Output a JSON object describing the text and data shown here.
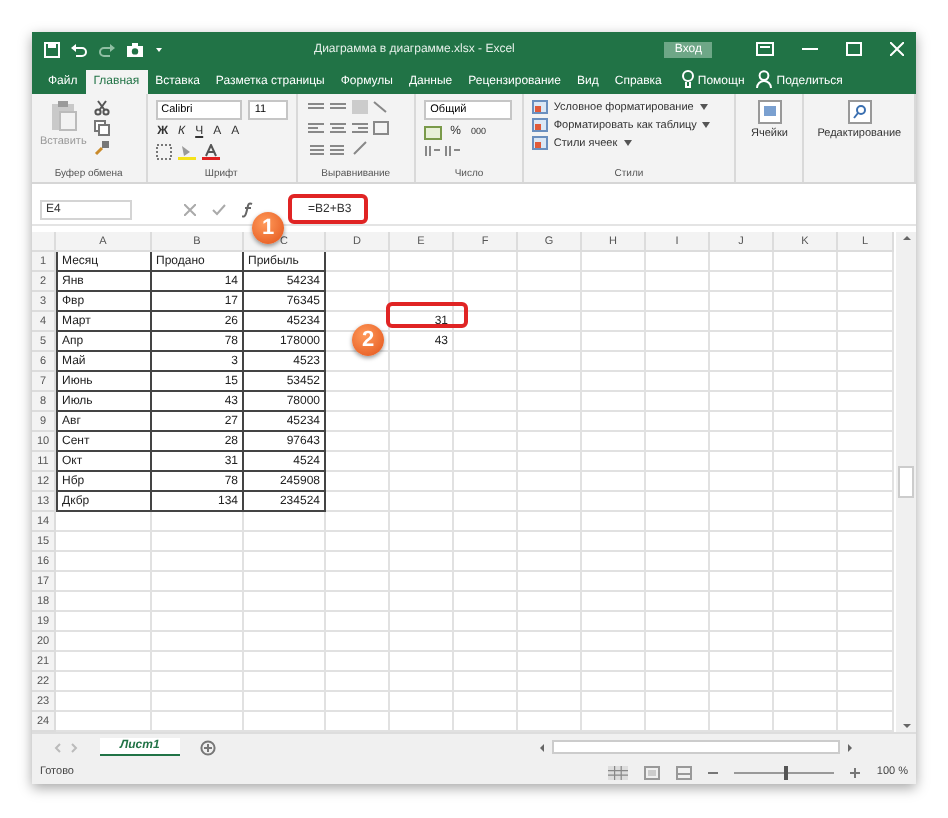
{
  "window": {
    "title": "Диаграмма в диаграмме.xlsx - Excel",
    "login_button": "Вход"
  },
  "menu_tabs": [
    {
      "label": "Файл",
      "selected": false
    },
    {
      "label": "Главная",
      "selected": true
    },
    {
      "label": "Вставка",
      "selected": false
    },
    {
      "label": "Разметка страницы",
      "selected": false
    },
    {
      "label": "Формулы",
      "selected": false
    },
    {
      "label": "Данные",
      "selected": false
    },
    {
      "label": "Рецензирование",
      "selected": false
    },
    {
      "label": "Вид",
      "selected": false
    },
    {
      "label": "Справка",
      "selected": false
    }
  ],
  "tell_me": "Помощн",
  "share": "Поделиться",
  "ribbon": {
    "clipboard": {
      "paste": "Вставить",
      "label": "Буфер обмена"
    },
    "font": {
      "font_name": "Calibri",
      "font_size": "11",
      "styles": [
        "Ж",
        "К",
        "Ч"
      ],
      "grow": "A",
      "shrink": "A",
      "label": "Шрифт"
    },
    "alignment": {
      "label": "Выравнивание"
    },
    "number": {
      "format": "Общий",
      "percent": "%",
      "thousands": "000",
      "label": "Число"
    },
    "styles": {
      "items": [
        "Условное форматирование",
        "Форматировать как таблицу",
        "Стили ячеек"
      ],
      "label": "Стили"
    },
    "cells": {
      "label": "Ячейки"
    },
    "editing": {
      "label": "Редактирование"
    }
  },
  "formula_bar": {
    "name_box": "E4",
    "formula": "=B2+B3"
  },
  "sheet": {
    "columns": [
      "A",
      "B",
      "C",
      "D",
      "E",
      "F",
      "G",
      "H",
      "I",
      "J",
      "K",
      "L"
    ],
    "rows": [
      {
        "number": "1",
        "kind": "header",
        "a": "Месяц",
        "b": "Продано",
        "c": "Прибыль"
      },
      {
        "number": "2",
        "kind": "data",
        "a": "Янв",
        "b": "14",
        "c": "54234"
      },
      {
        "number": "3",
        "kind": "data",
        "a": "Фвр",
        "b": "17",
        "c": "76345"
      },
      {
        "number": "4",
        "kind": "data",
        "a": "Март",
        "b": "26",
        "c": "45234",
        "e": "31"
      },
      {
        "number": "5",
        "kind": "data",
        "a": "Апр",
        "b": "78",
        "c": "178000",
        "e": "43"
      },
      {
        "number": "6",
        "kind": "data",
        "a": "Май",
        "b": "3",
        "c": "4523"
      },
      {
        "number": "7",
        "kind": "data",
        "a": "Июнь",
        "b": "15",
        "c": "53452"
      },
      {
        "number": "8",
        "kind": "data",
        "a": "Июль",
        "b": "43",
        "c": "78000"
      },
      {
        "number": "9",
        "kind": "data",
        "a": "Авг",
        "b": "27",
        "c": "45234"
      },
      {
        "number": "10",
        "kind": "data",
        "a": "Сент",
        "b": "28",
        "c": "97643"
      },
      {
        "number": "11",
        "kind": "data",
        "a": "Окт",
        "b": "31",
        "c": "4524"
      },
      {
        "number": "12",
        "kind": "data",
        "a": "Нбр",
        "b": "78",
        "c": "245908"
      },
      {
        "number": "13",
        "kind": "data",
        "a": "Дкбр",
        "b": "134",
        "c": "234524"
      },
      {
        "number": "14",
        "kind": "empty"
      },
      {
        "number": "15",
        "kind": "empty"
      },
      {
        "number": "16",
        "kind": "empty"
      },
      {
        "number": "17",
        "kind": "empty"
      },
      {
        "number": "18",
        "kind": "empty"
      },
      {
        "number": "19",
        "kind": "empty"
      },
      {
        "number": "20",
        "kind": "empty"
      },
      {
        "number": "21",
        "kind": "empty"
      },
      {
        "number": "22",
        "kind": "empty"
      },
      {
        "number": "23",
        "kind": "empty"
      },
      {
        "number": "24",
        "kind": "empty"
      }
    ]
  },
  "callouts": [
    {
      "label": "1"
    },
    {
      "label": "2"
    }
  ],
  "sheet_tabs": [
    {
      "label": "Лист1",
      "selected": true
    }
  ],
  "status_bar": {
    "status": "Готово",
    "zoom": "100 %",
    "level": 0.5
  }
}
